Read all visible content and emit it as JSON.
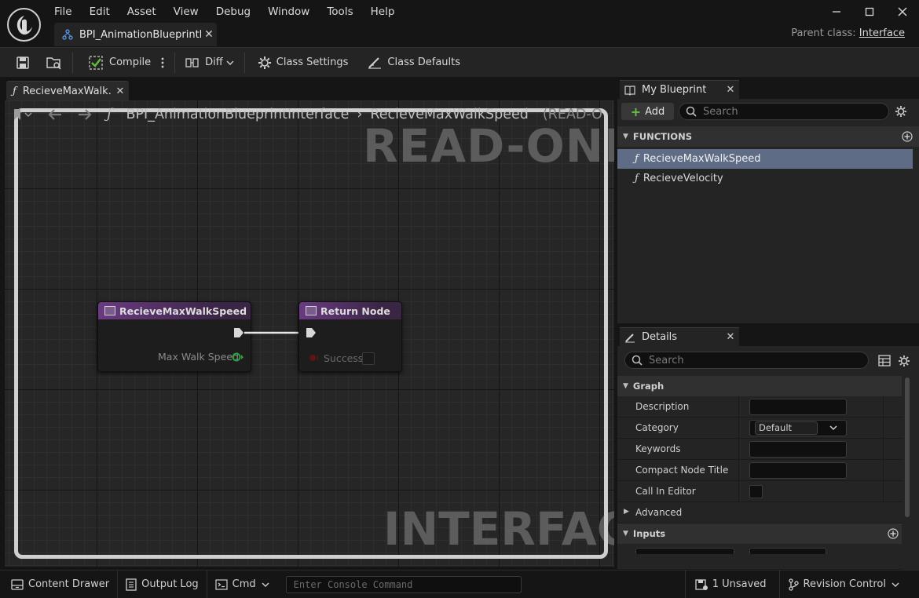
{
  "menu": [
    "File",
    "Edit",
    "Asset",
    "View",
    "Debug",
    "Window",
    "Tools",
    "Help"
  ],
  "document_tab": {
    "label": "BPI_AnimationBlueprintI..."
  },
  "parent_class": {
    "label": "Parent class:",
    "value": "Interface"
  },
  "toolbar": {
    "compile_label": "Compile",
    "diff_label": "Diff",
    "class_settings_label": "Class Settings",
    "class_defaults_label": "Class Defaults"
  },
  "graph": {
    "tab_label": "RecieveMaxWalk...",
    "breadcrumb_root": "BPI_AnimationBlueprintInterface",
    "breadcrumb_func": "RecieveMaxWalkSpeed",
    "breadcrumb_suffix": "(READ-O",
    "watermark_top": "READ-ONLY",
    "watermark_bottom": "INTERFACE",
    "nodes": {
      "entry_title": "RecieveMaxWalkSpeed",
      "entry_pin": "Max Walk Speed",
      "return_title": "Return Node",
      "return_pin": "Success"
    }
  },
  "my_blueprint": {
    "tab_label": "My Blueprint",
    "add_label": "Add",
    "search_placeholder": "Search",
    "functions_header": "FUNCTIONS",
    "functions": [
      "RecieveMaxWalkSpeed",
      "RecieveVelocity"
    ],
    "selected_function": "RecieveMaxWalkSpeed"
  },
  "details": {
    "tab_label": "Details",
    "search_placeholder": "Search",
    "graph_header": "Graph",
    "rows": {
      "description": "Description",
      "category": "Category",
      "category_value": "Default",
      "keywords": "Keywords",
      "compact_node_title": "Compact Node Title",
      "call_in_editor": "Call In Editor"
    },
    "advanced_label": "Advanced",
    "inputs_header": "Inputs"
  },
  "statusbar": {
    "content_drawer": "Content Drawer",
    "output_log": "Output Log",
    "cmd": "Cmd",
    "console_placeholder": "Enter Console Command",
    "unsaved": "1 Unsaved",
    "revision_control": "Revision Control"
  },
  "colors": {
    "node_header_purple": "#6b3a82",
    "selection_blue": "#5e6d85",
    "add_plus_green": "#6cc04a",
    "pin_green": "#2c9e3c"
  }
}
